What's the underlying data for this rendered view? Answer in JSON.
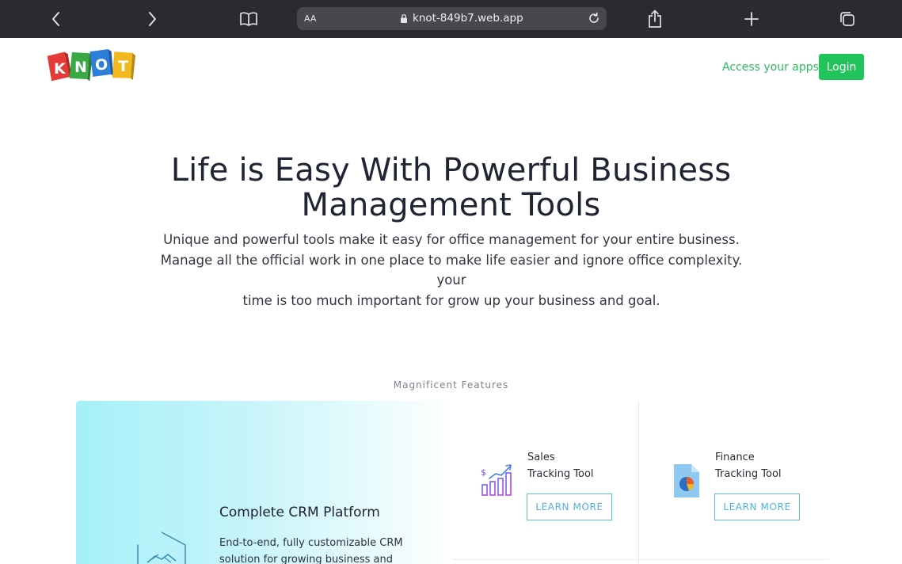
{
  "browser": {
    "text_size_label": "AA",
    "url": "knot-849b7.web.app"
  },
  "header": {
    "logo_letters": [
      "K",
      "N",
      "O",
      "T"
    ],
    "access_link": "Access your apps",
    "login_label": "Login"
  },
  "hero": {
    "title_line1": "Life is Easy With Powerful Business",
    "title_line2": "Management Tools",
    "subtitle_line1": "Unique and powerful tools make it easy for office management for your entire business.",
    "subtitle_line2": "Manage all the official work in one place to make life easier and ignore office complexity. your",
    "subtitle_line3": "time is too much important for grow up your business and goal."
  },
  "features": {
    "section_label": "Magnificent Features",
    "crm": {
      "title": "Complete CRM Platform",
      "desc_line1": "End-to-end, fully customizable CRM",
      "desc_line2": "solution for growing business and"
    },
    "tools": [
      {
        "line1": "Sales",
        "line2": "Tracking Tool",
        "button": "LEARN MORE",
        "icon": "sales-chart-icon"
      },
      {
        "line1": "Finance",
        "line2": "Tracking Tool",
        "button": "LEARN MORE",
        "icon": "finance-report-icon"
      }
    ]
  },
  "colors": {
    "brand_green": "#21c45a",
    "link_green": "#2bbf5b",
    "learn_blue": "#4fb2de",
    "crm_gradient_start": "#a6f0f9"
  }
}
